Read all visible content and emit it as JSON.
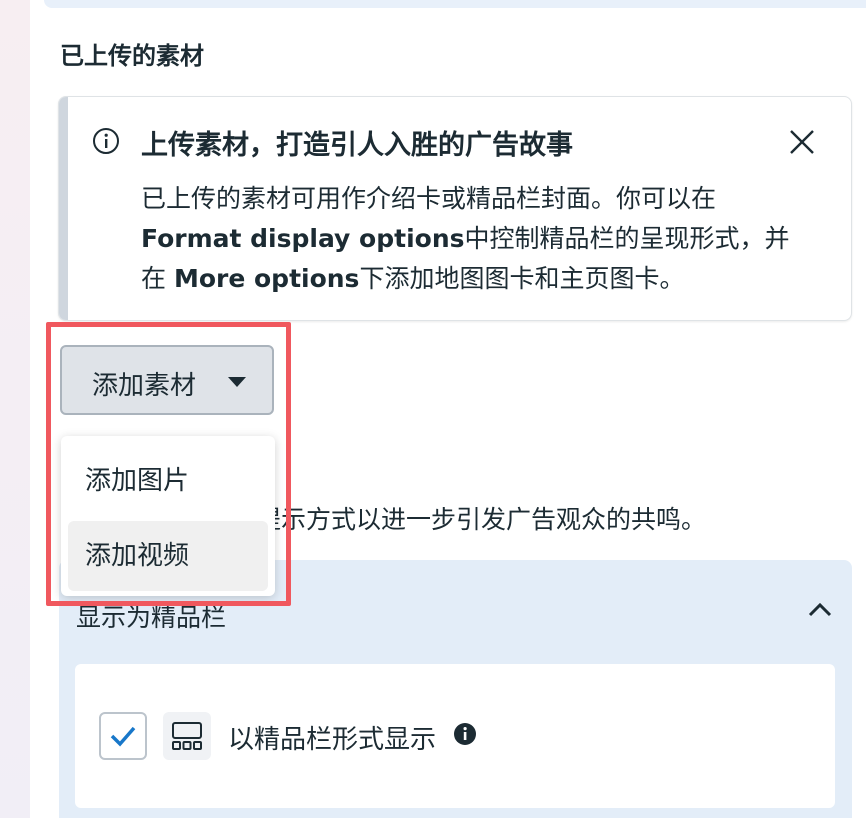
{
  "section": {
    "title": "已上传的素材"
  },
  "info": {
    "title": "上传素材，打造引人入胜的广告故事",
    "line1": "已上传的素材可用作介绍卡或精品栏封面。你可以在",
    "line2_bold": "Format display options",
    "line2_rest": "中控制精品栏的呈现形式，并",
    "line3_pre": "在 ",
    "line3_bold": "More options",
    "line3_rest": "下添加地图图卡和主页图卡。"
  },
  "add_button": {
    "label": "添加素材"
  },
  "dropdown": {
    "items": [
      "添加图片",
      "添加视频"
    ]
  },
  "partial_text": "提示方式以进一步引发广告观众的共鸣。",
  "collection": {
    "title": "显示为精品栏",
    "option_label": "以精品栏形式显示",
    "checked": true
  },
  "colors": {
    "highlight": "#f0585e",
    "panel_bg": "#e3edf8",
    "check": "#1877c9"
  },
  "icons": [
    "info-icon",
    "close-icon",
    "caret-down-icon",
    "chevron-up-icon",
    "checkmark-icon",
    "collection-layout-icon",
    "info-solid-icon"
  ]
}
